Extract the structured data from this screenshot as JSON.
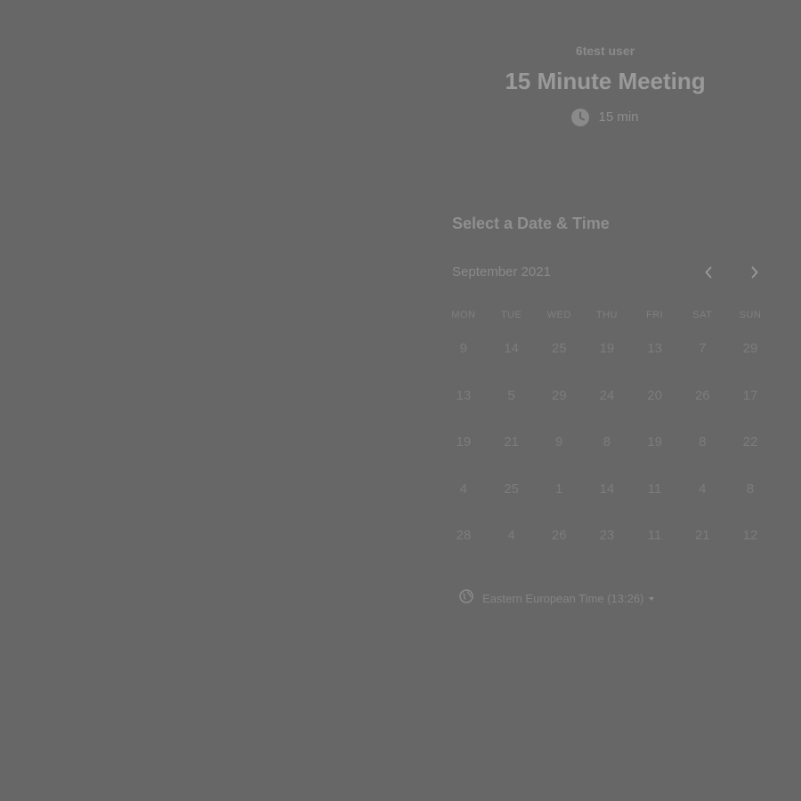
{
  "organizer": {
    "name": "6test user"
  },
  "event": {
    "title": "15 Minute Meeting",
    "duration": "15 min",
    "duration_icon": "clock-icon"
  },
  "picker": {
    "heading": "Select a Date & Time",
    "month_label": "September 2021",
    "prev_icon": "chevron-left-icon",
    "next_icon": "chevron-right-icon",
    "weekdays": [
      "MON",
      "TUE",
      "WED",
      "THU",
      "FRI",
      "SAT",
      "SUN"
    ],
    "weeks": [
      [
        "9",
        "14",
        "25",
        "19",
        "13",
        "7",
        "29"
      ],
      [
        "13",
        "5",
        "29",
        "24",
        "20",
        "26",
        "17"
      ],
      [
        "19",
        "21",
        "9",
        "8",
        "19",
        "8",
        "22"
      ],
      [
        "4",
        "25",
        "1",
        "14",
        "11",
        "4",
        "8"
      ],
      [
        "28",
        "4",
        "26",
        "23",
        "11",
        "21",
        "12"
      ]
    ]
  },
  "timezone": {
    "label": "Eastern European Time (13:26)",
    "icon": "globe-icon"
  },
  "colors": {
    "background": "#676767",
    "text": "#8a8a8a"
  }
}
